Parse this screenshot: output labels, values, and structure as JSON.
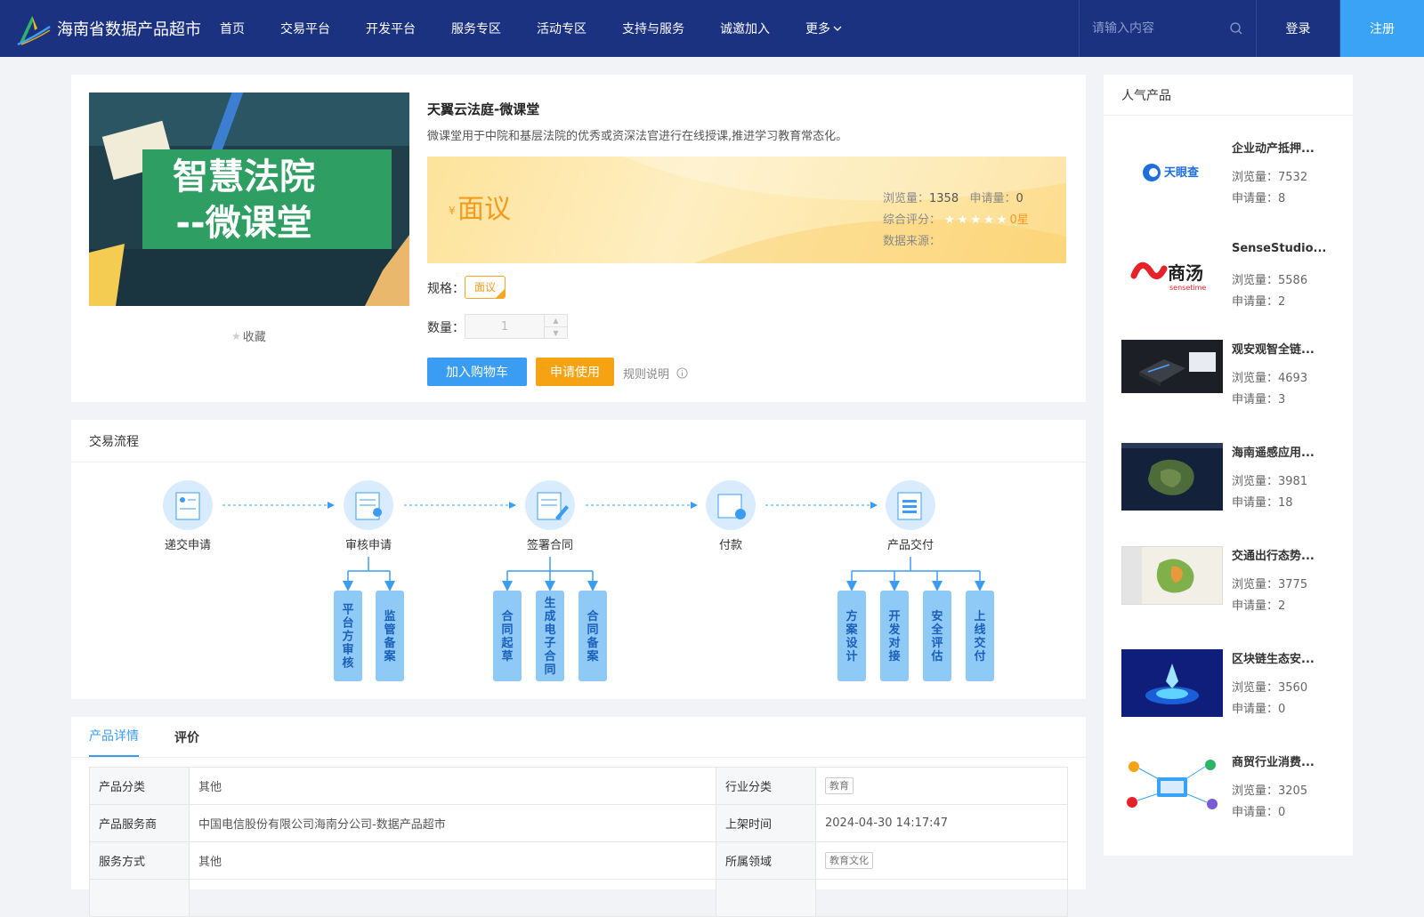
{
  "header": {
    "site_title": "海南省数据产品超市",
    "nav": [
      "首页",
      "交易平台",
      "开发平台",
      "服务专区",
      "活动专区",
      "支持与服务",
      "诚邀加入",
      "更多"
    ],
    "search_placeholder": "请输入内容",
    "login": "登录",
    "register": "注册"
  },
  "product": {
    "image_title_line1": "智慧法院",
    "image_title_line2": "--微课堂",
    "favorite": "收藏",
    "title": "天翼云法庭-微课堂",
    "description": "微课堂用于中院和基层法院的优秀或资深法官进行在线授课,推进学习教育常态化。",
    "currency": "¥",
    "price": "面议",
    "views_label": "浏览量：",
    "views": "1358",
    "applies_label": "申请量：",
    "applies": "0",
    "rating_label": "综合评分：",
    "rating": 0,
    "rating_text": "0星",
    "source_label": "数据来源：",
    "source": "",
    "spec_label": "规格：",
    "spec_value": "面议",
    "qty_label": "数量：",
    "qty_value": "1",
    "add_cart": "加入购物车",
    "apply": "申请使用",
    "rules": "规则说明"
  },
  "process": {
    "title": "交易流程",
    "steps": [
      "递交申请",
      "审核申请",
      "签署合同",
      "付款",
      "产品交付"
    ],
    "sub_steps": {
      "审核申请": [
        "平台方审核",
        "监管备案"
      ],
      "签署合同": [
        "合同起草",
        "生成电子合同",
        "合同备案"
      ],
      "产品交付": [
        "方案设计",
        "开发对接",
        "安全评估",
        "上线交付"
      ]
    }
  },
  "details": {
    "tabs": [
      "产品详情",
      "评价"
    ],
    "rows": [
      {
        "k1": "产品分类",
        "v1": "其他",
        "k2": "行业分类",
        "v2": "教育"
      },
      {
        "k1": "产品服务商",
        "v1": "中国电信股份有限公司海南分公司-数据产品超市",
        "k2": "上架时间",
        "v2": "2024-04-30 14:17:47"
      },
      {
        "k1": "服务方式",
        "v1": "其他",
        "k2": "所属领域",
        "v2": "教育文化"
      }
    ]
  },
  "popular": {
    "title": "人气产品",
    "views_label": "浏览量：",
    "applies_label": "申请量：",
    "items": [
      {
        "title": "企业动产抵押...",
        "views": "7532",
        "applies": "8",
        "logo_text": "天眼查"
      },
      {
        "title": "SenseStudio...",
        "views": "5586",
        "applies": "2",
        "logo_text": "商汤",
        "logo_sub": "sensetime"
      },
      {
        "title": "观安观智全链...",
        "views": "4693",
        "applies": "3"
      },
      {
        "title": "海南遥感应用...",
        "views": "3981",
        "applies": "18"
      },
      {
        "title": "交通出行态势...",
        "views": "3775",
        "applies": "2"
      },
      {
        "title": "区块链生态安...",
        "views": "3560",
        "applies": "0"
      },
      {
        "title": "商贸行业消费...",
        "views": "3205",
        "applies": "0"
      }
    ]
  }
}
